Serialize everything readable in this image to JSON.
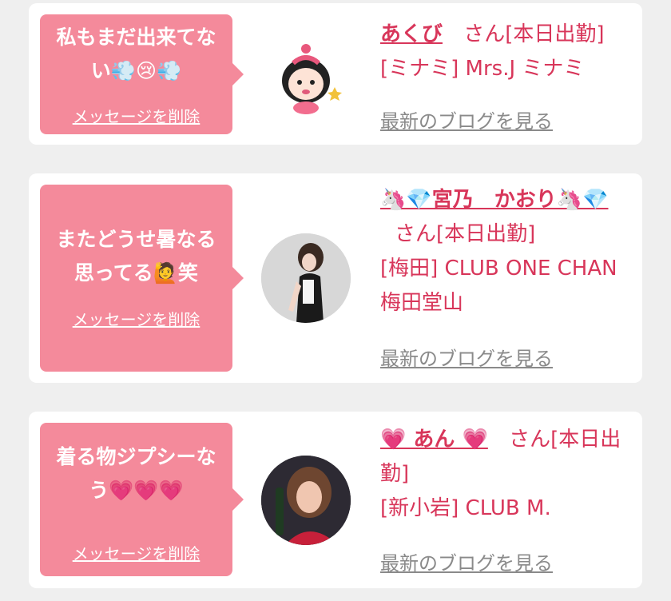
{
  "cards": [
    {
      "message": "私もまだ出来てない💨😢💨",
      "delete_label": "メッセージを削除",
      "name": "あくび",
      "honorific": "さん[本日出勤]",
      "shop": "[ミナミ] Mrs.J ミナミ",
      "blog_label": "最新のブログを見る"
    },
    {
      "message": "またどうせ暑なる思ってる🙋笑",
      "delete_label": "メッセージを削除",
      "name": "🦄💎宮乃　かおり🦄💎",
      "honorific": "さん[本日出勤]",
      "shop": "[梅田] CLUB ONE CHAN 梅田堂山",
      "blog_label": "最新のブログを見る"
    },
    {
      "message": "着る物ジプシーなう💗💗💗",
      "delete_label": "メッセージを削除",
      "name": "💗 あん 💗",
      "honorific": "さん[本日出勤]",
      "shop": "[新小岩] CLUB M.",
      "blog_label": "最新のブログを見る"
    }
  ],
  "colors": {
    "bubble": "#f48a9b",
    "name": "#d8365a",
    "blog_link": "#8a8a8a",
    "background": "#efefef"
  }
}
